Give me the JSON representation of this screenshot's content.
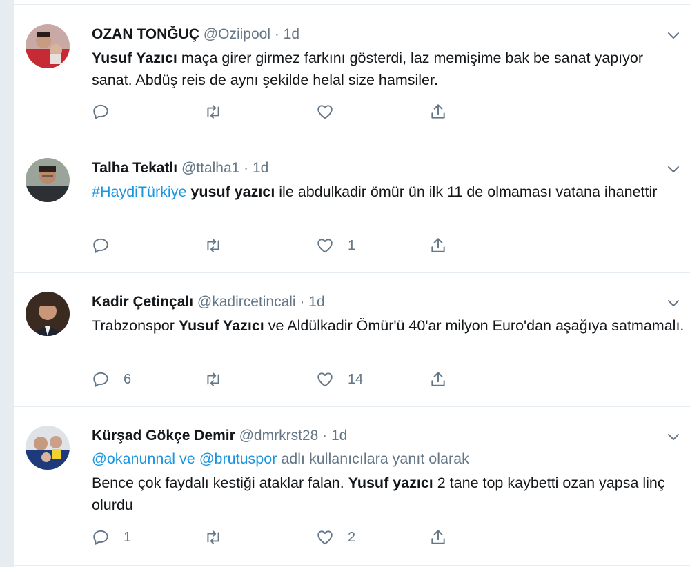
{
  "tweets": [
    {
      "name": "OZAN TONĞUÇ",
      "handle": "@Oziipool",
      "dot": "·",
      "time": "1d",
      "parts": [
        {
          "t": "Yusuf Yazıcı",
          "bold": true
        },
        {
          "t": " maça girer girmez farkını gösterdi, laz memişime bak be sanat yapıyor sanat. Abdüş reis de aynı şekilde helal size hamsiler."
        }
      ],
      "reply_count": "",
      "like_count": ""
    },
    {
      "name": "Talha Tekatlı",
      "handle": "@ttalha1",
      "dot": "·",
      "time": "1d",
      "parts": [
        {
          "t": "#HaydiTürkiye",
          "link": true
        },
        {
          "t": " "
        },
        {
          "t": "yusuf yazıcı",
          "bold": true
        },
        {
          "t": " ile abdulkadir ömür ün ilk 11 de olmaması vatana ihanettir"
        }
      ],
      "reply_count": "",
      "like_count": "1"
    },
    {
      "name": "Kadir Çetinçalı",
      "handle": "@kadircetincali",
      "dot": "·",
      "time": "1d",
      "parts": [
        {
          "t": "Trabzonspor "
        },
        {
          "t": "Yusuf Yazıcı",
          "bold": true
        },
        {
          "t": " ve Aldülkadir Ömür'ü 40'ar milyon Euro'dan aşağıya satmamalı."
        }
      ],
      "reply_count": "6",
      "like_count": "14"
    },
    {
      "name": "Kürşad Gökçe Demir",
      "handle": "@dmrkrst28",
      "dot": "·",
      "time": "1d",
      "reply_context": {
        "user1": "@okanunnal",
        "conj": " ve ",
        "user2": "@brutuspor",
        "suffix": " adlı kullanıcılara yanıt olarak"
      },
      "parts": [
        {
          "t": "Bence çok faydalı kestiği ataklar falan. "
        },
        {
          "t": "Yusuf yazıcı",
          "bold": true
        },
        {
          "t": " 2 tane top kaybetti ozan yapsa linç olurdu"
        }
      ],
      "reply_count": "1",
      "like_count": "2"
    }
  ],
  "colors": {
    "name": "#14171a",
    "secondary": "#657786",
    "link": "#1b95e0",
    "divider": "#e6ecf0"
  },
  "icons": [
    "reply-icon",
    "retweet-icon",
    "like-icon",
    "share-icon",
    "chevron-down-icon"
  ]
}
